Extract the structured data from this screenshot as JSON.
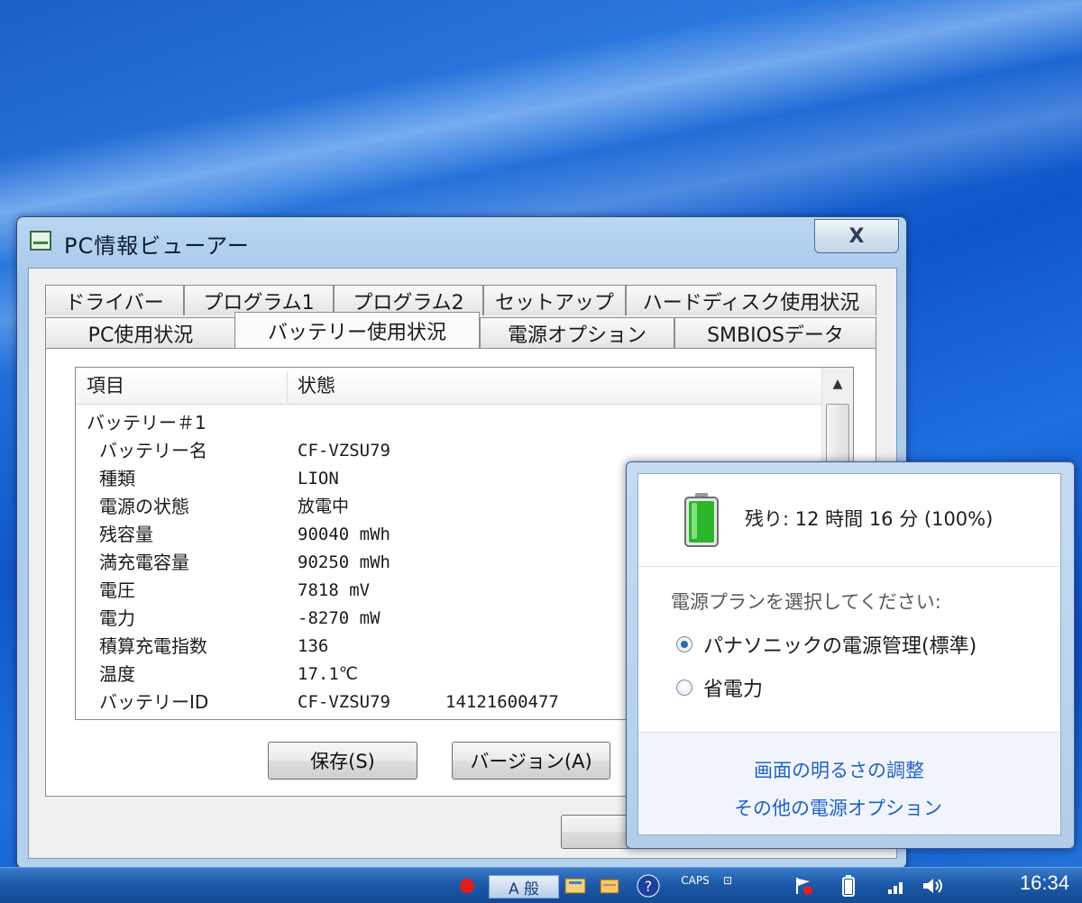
{
  "window": {
    "title": "PC情報ビューアー",
    "close_label": "X"
  },
  "tabs": {
    "row1": [
      "ドライバー",
      "プログラム1",
      "プログラム2",
      "セットアップ",
      "ハードディスク使用状況"
    ],
    "row2": [
      "PC使用状況",
      "バッテリー使用状況",
      "電源オプション",
      "SMBIOSデータ"
    ],
    "active": "バッテリー使用状況"
  },
  "list": {
    "columns": [
      "項目",
      "状態"
    ],
    "group": "バッテリー＃1",
    "rows": [
      {
        "key": "バッテリー名",
        "value": "CF-VZSU79",
        "extra": ""
      },
      {
        "key": "種類",
        "value": "LION",
        "extra": ""
      },
      {
        "key": "電源の状態",
        "value": "放電中",
        "extra": ""
      },
      {
        "key": "残容量",
        "value": "90040 mWh",
        "extra": ""
      },
      {
        "key": "満充電容量",
        "value": "90250 mWh",
        "extra": ""
      },
      {
        "key": "電圧",
        "value": "7818 mV",
        "extra": ""
      },
      {
        "key": "電力",
        "value": "-8270 mW",
        "extra": ""
      },
      {
        "key": "積算充電指数",
        "value": "136",
        "extra": ""
      },
      {
        "key": "温度",
        "value": "17.1℃",
        "extra": ""
      },
      {
        "key": "バッテリーID",
        "value": "CF-VZSU79",
        "extra": "14121600477"
      }
    ]
  },
  "buttons": {
    "save": "保存(S)",
    "version": "バージョン(A)"
  },
  "battery_flyout": {
    "remaining": "残り: 12 時間 16 分 (100%)",
    "charge_fraction": 1.0,
    "plan_prompt": "電源プランを選択してください:",
    "plans": [
      {
        "label": "パナソニックの電源管理(標準)",
        "selected": true
      },
      {
        "label": "省電力",
        "selected": false
      }
    ],
    "links": [
      "画面の明るさの調整",
      "その他の電源オプション"
    ]
  },
  "taskbar": {
    "caps": "CAPS",
    "ime": "A 般",
    "clock": "16:34"
  },
  "colors": {
    "link": "#1f61c8",
    "battery_green": "#2bb52b",
    "taskbar": "#1d5aa8"
  }
}
